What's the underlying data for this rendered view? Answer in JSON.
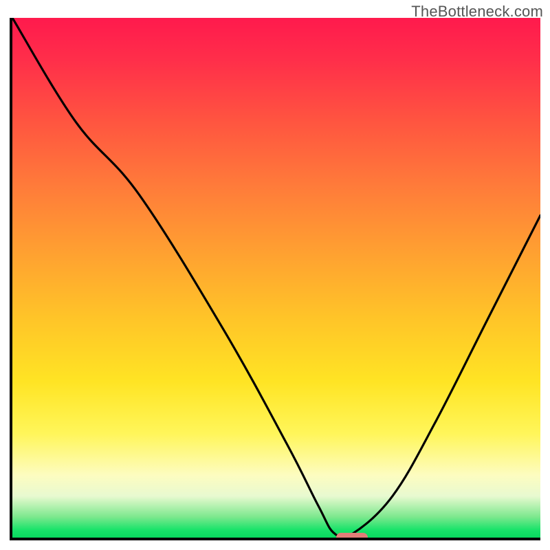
{
  "watermark": "TheBottleneck.com",
  "chart_data": {
    "type": "line",
    "title": "",
    "xlabel": "",
    "ylabel": "",
    "xlim": [
      0,
      100
    ],
    "ylim": [
      0,
      100
    ],
    "grid": false,
    "legend": false,
    "series": [
      {
        "name": "bottleneck-curve",
        "x": [
          0,
          12,
          24,
          40,
          52,
          58,
          61,
          64.5,
          72,
          80,
          90,
          100
        ],
        "y": [
          100,
          80,
          66,
          40,
          18,
          6,
          0.8,
          0.8,
          8,
          22,
          42,
          62
        ]
      }
    ],
    "marker": {
      "x_start": 61,
      "x_end": 67,
      "y": 0.5,
      "color": "#e27e78",
      "shape": "pill"
    },
    "background_gradient": {
      "top": "#ff1a4d",
      "upper_mid": "#ffa031",
      "mid": "#ffe424",
      "lower_mid": "#fdfcc0",
      "bottom": "#08d95f"
    }
  }
}
